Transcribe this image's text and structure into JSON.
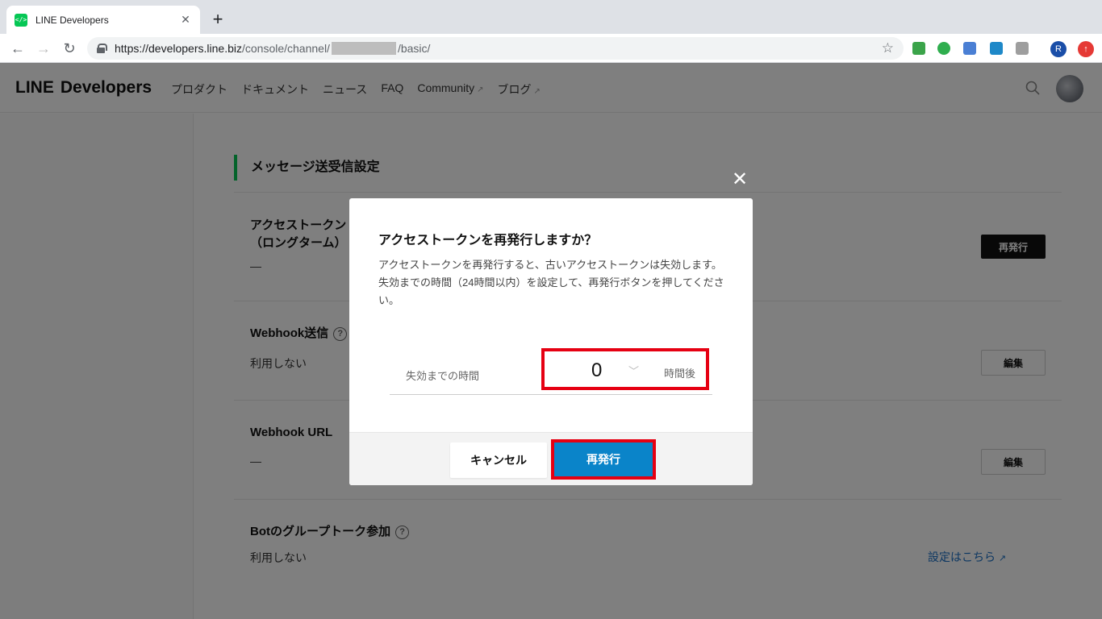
{
  "browser": {
    "tab_title": "LINE Developers",
    "tab_close": "✕",
    "new_tab": "+",
    "url_host": "https://developers.line.biz",
    "url_path_1": "/console/channel/",
    "url_path_2": "/basic/",
    "profile_initial": "R",
    "star_icon": "☆"
  },
  "header": {
    "logo_line": "LINE",
    "logo_developers": "Developers",
    "nav": [
      "プロダクト",
      "ドキュメント",
      "ニュース",
      "FAQ",
      "Community",
      "ブログ"
    ]
  },
  "page": {
    "section_title": "メッセージ送受信設定",
    "rows": {
      "access_token_label_1": "アクセストークン",
      "access_token_label_2": "（ロングターム）",
      "access_token_value": "—",
      "access_token_button": "再発行",
      "webhook_send_label": "Webhook送信",
      "webhook_send_value": "利用しない",
      "webhook_send_button": "編集",
      "webhook_url_label": "Webhook URL",
      "webhook_url_value": "—",
      "webhook_url_button": "編集",
      "bot_group_label": "Botのグループトーク参加",
      "bot_group_value": "利用しない",
      "bot_group_link": "設定はこちら"
    },
    "help_mark": "?"
  },
  "modal": {
    "close": "✕",
    "title": "アクセストークンを再発行しますか？",
    "desc_1": "アクセストークンを再発行すると、古いアクセストークンは失効します。",
    "desc_2": "失効までの時間（24時間以内）を設定して、再発行ボタンを押してください。",
    "field_label": "失効までの時間",
    "field_value": "0",
    "field_unit": "時間後",
    "cancel_button": "キャンセル",
    "reissue_button": "再発行"
  },
  "colors": {
    "line_green": "#06c755",
    "primary_blue": "#0a84c9",
    "highlight_red": "#e60012"
  }
}
